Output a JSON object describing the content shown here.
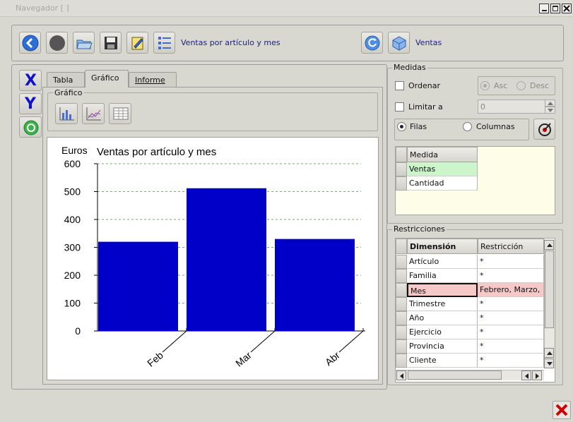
{
  "window": {
    "title": "Navegador [  ]"
  },
  "toolbar": {
    "query_title": "Ventas por artículo y mes",
    "cube_label": "Ventas"
  },
  "tabs": [
    "Tabla",
    "Gráfico",
    "Informe"
  ],
  "grafico_group": {
    "legend": "Gráfico"
  },
  "axis_buttons": {
    "x_label": "X",
    "y_label": "Y"
  },
  "chart_data": {
    "type": "bar",
    "title": "Ventas por artículo y mes",
    "ylabel": "Euros",
    "xlabel": "",
    "categories": [
      "Feb",
      "Mar",
      "Abr"
    ],
    "values": [
      320,
      512,
      330
    ],
    "ylim": [
      0,
      600
    ],
    "yticks": [
      0,
      100,
      200,
      300,
      400,
      500,
      600
    ],
    "bar_color": "#0000c8",
    "grid": true
  },
  "medidas": {
    "legend": "Medidas",
    "ordenar_label": "Ordenar",
    "asc_label": "Asc",
    "desc_label": "Desc",
    "limitar_label": "Limitar a",
    "limit_value": "0",
    "filas_label": "Filas",
    "columnas_label": "Columnas",
    "table_header": "Medida",
    "rows": [
      "Ventas",
      "Cantidad"
    ]
  },
  "restricciones": {
    "legend": "Restricciones",
    "headers": [
      "Dimensión",
      "Restricción"
    ],
    "rows": [
      {
        "dimension": "Artículo",
        "restriccion": "*"
      },
      {
        "dimension": "Familia",
        "restriccion": "*"
      },
      {
        "dimension": "Mes",
        "restriccion": "Febrero, Marzo,"
      },
      {
        "dimension": "Trimestre",
        "restriccion": "*"
      },
      {
        "dimension": "Año",
        "restriccion": "*"
      },
      {
        "dimension": "Ejercicio",
        "restriccion": "*"
      },
      {
        "dimension": "Provincia",
        "restriccion": "*"
      },
      {
        "dimension": "Cliente",
        "restriccion": "*"
      }
    ]
  },
  "colors": {
    "accent_blue": "#0000c8",
    "selected_green": "#ccf5cc",
    "selected_red": "#f6c8c8",
    "close_red": "#cc0000"
  }
}
